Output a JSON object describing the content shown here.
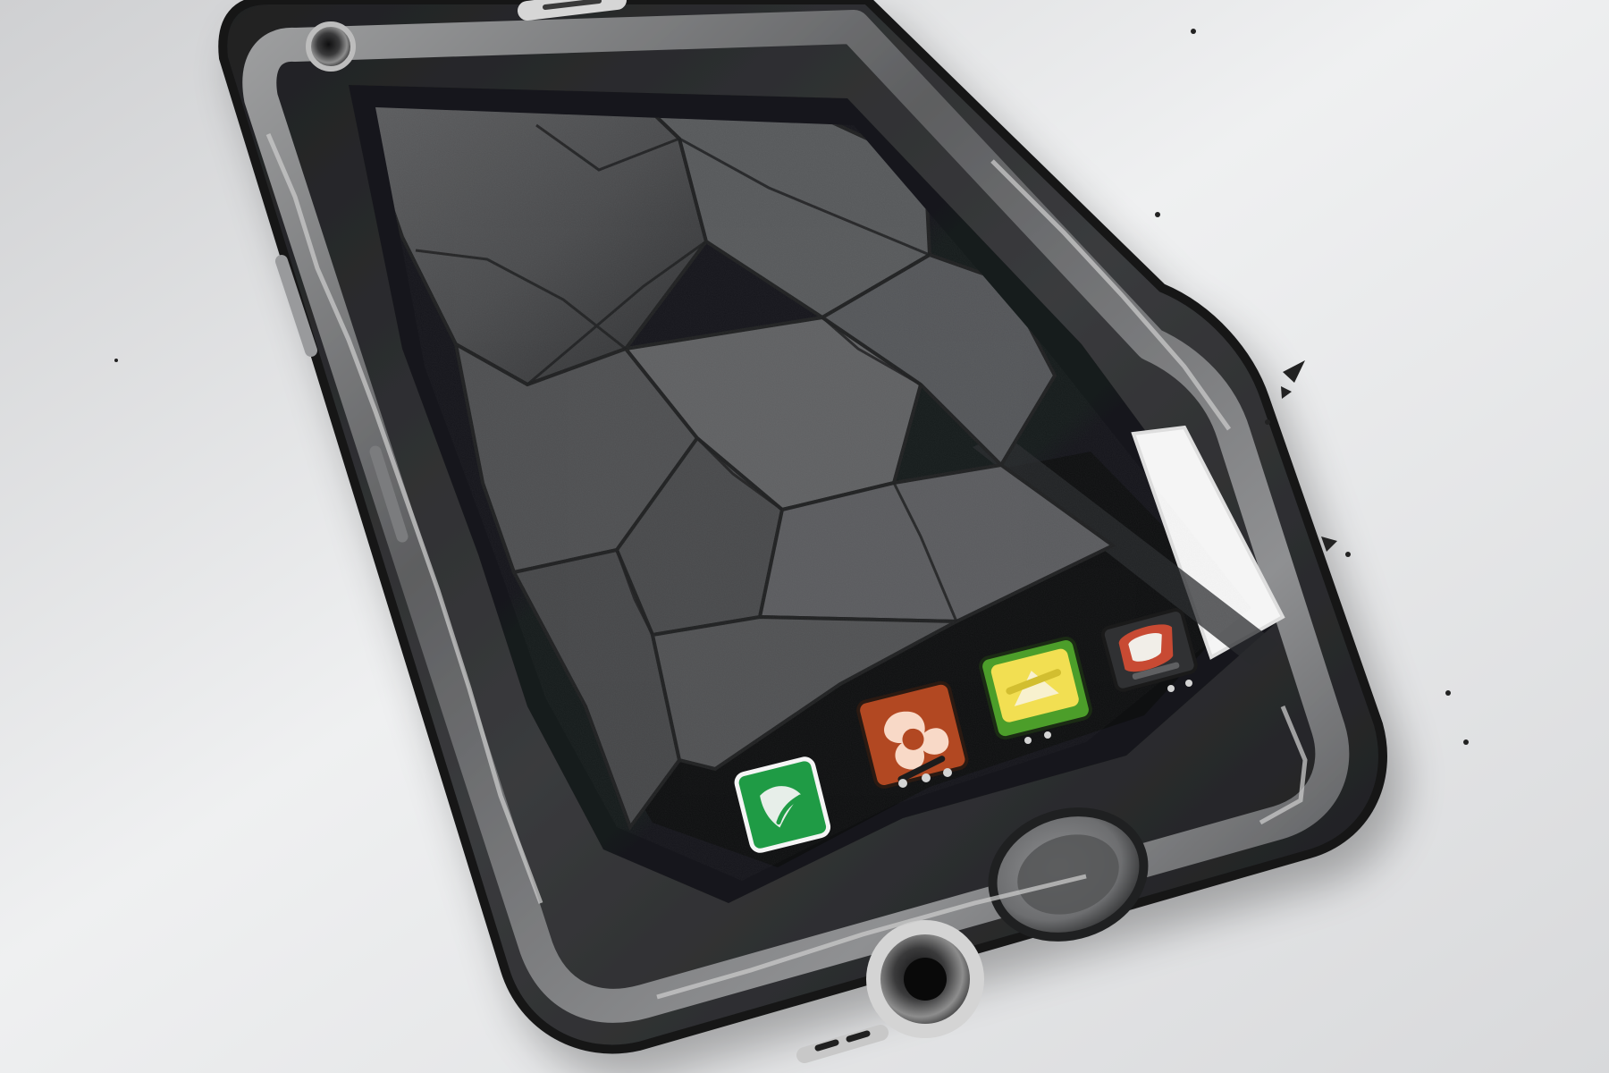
{
  "scene": {
    "subject": "broken-smartphone",
    "background_color": "#e9eaeb",
    "phone_body_color": "#2e2f31",
    "phone_rim_color": "#6d6e70",
    "glass_color": "#4f5052",
    "exposed_interior_color": "#101112",
    "white_panel_color": "#f5f5f5",
    "home_button_color": "#777879",
    "camera_ring_color": "#3a3a3a"
  },
  "apps": [
    {
      "name": "green-app-icon",
      "color": "#1f9b45",
      "accent": "#f2f2f2"
    },
    {
      "name": "orange-app-icon",
      "color": "#b24822",
      "accent": "#f8d9c7"
    },
    {
      "name": "yellow-green-app-icon",
      "color": "#4c9e2a",
      "accent": "#f2df52"
    },
    {
      "name": "red-app-icon",
      "color": "#c84a33",
      "accent": "#f1eee8"
    }
  ],
  "debris": {
    "type": "small-dark-fragments",
    "color": "#222222"
  }
}
